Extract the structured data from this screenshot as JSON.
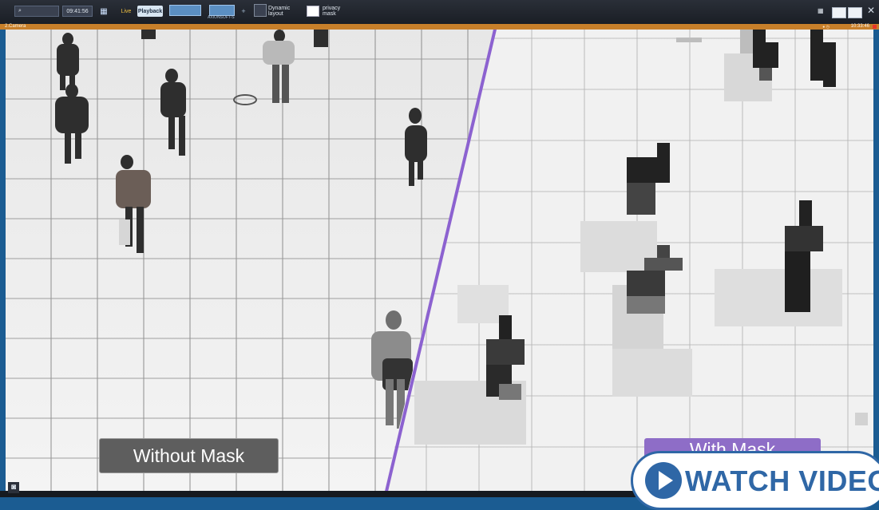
{
  "toolbar": {
    "search_icon": "search-icon",
    "time": "09:41:56",
    "live_label": "Live",
    "playback_label": "Playback",
    "camera_mini": "AXIONSOFT-S",
    "dynamic_layout_label": "Dynamic layout",
    "layout_name": "privacy mask"
  },
  "camera": {
    "name": "2.Camera",
    "timestamp": "10:33:46"
  },
  "overlay": {
    "without_label": "Without Mask",
    "with_label": "With Mask",
    "watch_label": "WATCH VIDEO"
  },
  "colors": {
    "toolbar_bg": "#1a1e25",
    "camera_header": "#c77f2a",
    "divider": "#8c62d0",
    "with_mask_badge": "#8e6dc7",
    "watch_button": "#2f67a6"
  }
}
